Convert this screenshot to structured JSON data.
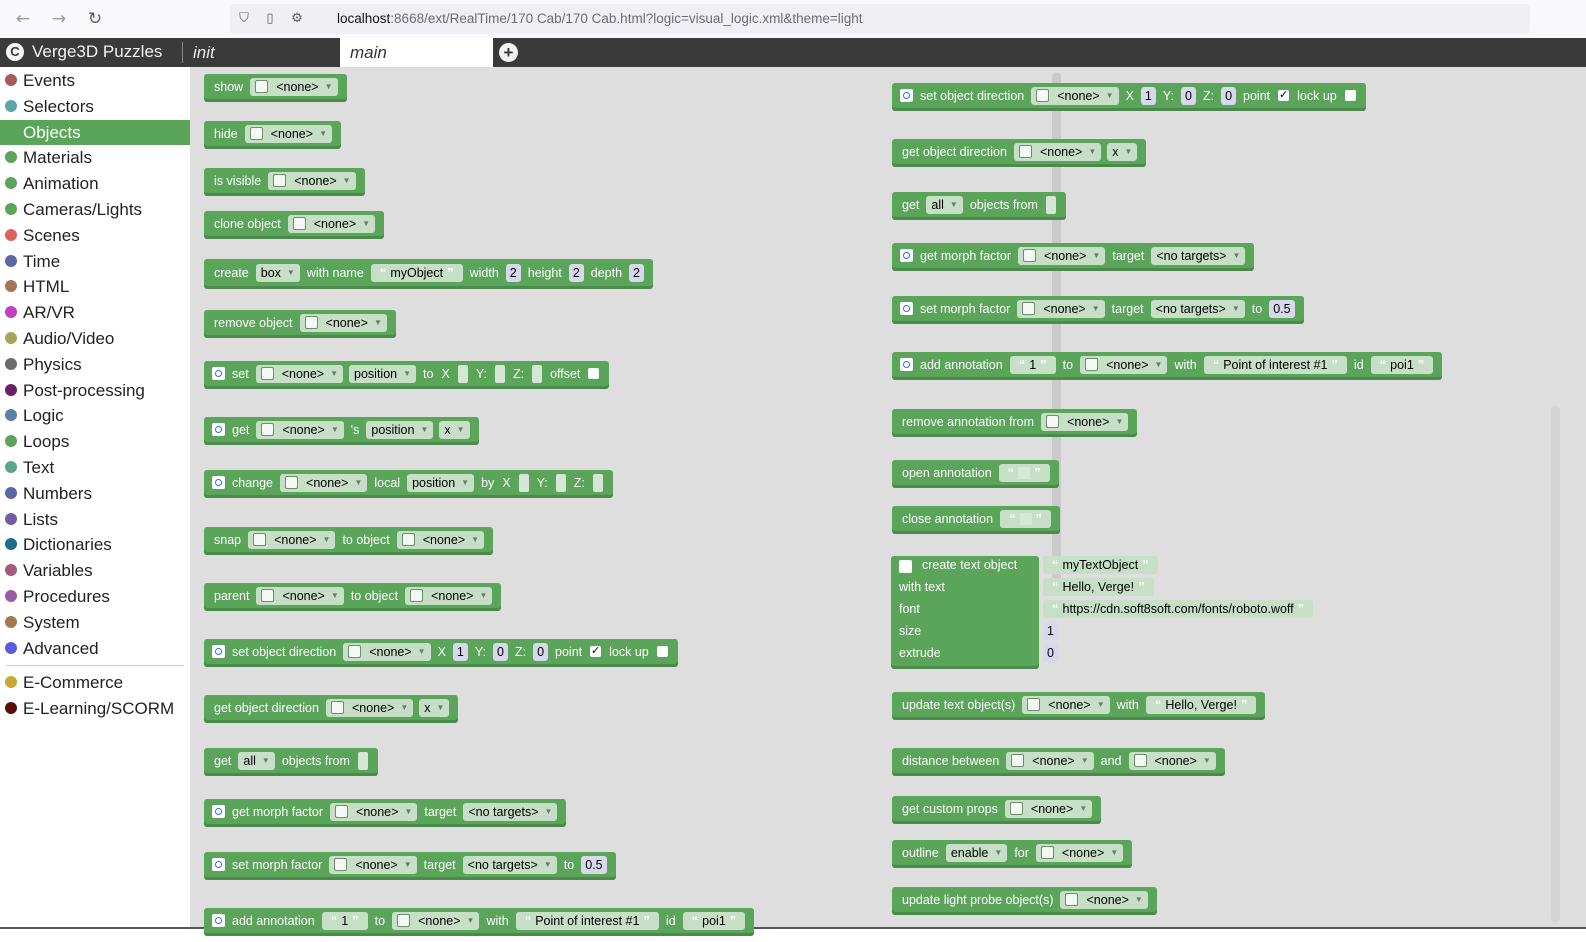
{
  "browser": {
    "url_host": "localhost",
    "url_rest": ":8668/ext/RealTime/170 Cab/170 Cab.html?logic=visual_logic.xml&theme=light"
  },
  "app": {
    "title": "Verge3D Puzzles",
    "tabs": [
      "init",
      "main"
    ]
  },
  "sidebar": {
    "categories": [
      {
        "label": "Events",
        "color": "#a55b5b"
      },
      {
        "label": "Selectors",
        "color": "#5ba5a5"
      },
      {
        "label": "Objects",
        "color": "#5ba55b"
      },
      {
        "label": "Materials",
        "color": "#5ba55b"
      },
      {
        "label": "Animation",
        "color": "#5ba55b"
      },
      {
        "label": "Cameras/Lights",
        "color": "#5ba55b"
      },
      {
        "label": "Scenes",
        "color": "#e06060"
      },
      {
        "label": "Time",
        "color": "#5b67a5"
      },
      {
        "label": "HTML",
        "color": "#a5745b"
      },
      {
        "label": "AR/VR",
        "color": "#c040c0"
      },
      {
        "label": "Audio/Video",
        "color": "#a5a55b"
      },
      {
        "label": "Physics",
        "color": "#6b6b6b"
      },
      {
        "label": "Post-processing",
        "color": "#6b1f6b"
      },
      {
        "label": "Logic",
        "color": "#5b80a5"
      },
      {
        "label": "Loops",
        "color": "#5ba55b"
      },
      {
        "label": "Text",
        "color": "#5ba58c"
      },
      {
        "label": "Numbers",
        "color": "#5b67a5"
      },
      {
        "label": "Lists",
        "color": "#745ba5"
      },
      {
        "label": "Dictionaries",
        "color": "#1f6b8c"
      },
      {
        "label": "Variables",
        "color": "#a55b80"
      },
      {
        "label": "Procedures",
        "color": "#995ba5"
      },
      {
        "label": "System",
        "color": "#a57a4a"
      },
      {
        "label": "Advanced",
        "color": "#5b5be0"
      },
      {
        "label": "E-Commerce",
        "color": "#c8a830"
      },
      {
        "label": "E-Learning/SCORM",
        "color": "#5a0f0f"
      }
    ],
    "selected": "Objects"
  },
  "blocks": {
    "show": "show",
    "hide": "hide",
    "is_visible": "is visible",
    "clone_object": "clone object",
    "none": "<none>",
    "create": "create",
    "box": "box",
    "with_name": "with name",
    "myObject": "myObject",
    "width": "width",
    "height": "height",
    "depth": "depth",
    "two": "2",
    "remove_object": "remove object",
    "set": "set",
    "position": "position",
    "to": "to",
    "x": "X",
    "y": "Y:",
    "z": "Z:",
    "offset": "offset",
    "get": "get",
    "s_position": "'s",
    "x_lower": "x",
    "change": "change",
    "local": "local",
    "by": "by",
    "snap": "snap",
    "to_object": "to object",
    "parent": "parent",
    "set_object_direction": "set object direction",
    "one": "1",
    "zero": "0",
    "point": "point",
    "check": "✓",
    "lock_up": "lock up",
    "get_object_direction": "get object direction",
    "all": "all",
    "objects_from": "objects from",
    "get_morph_factor": "get morph factor",
    "target": "target",
    "no_targets": "<no targets>",
    "set_morph_factor": "set morph factor",
    "half": "0.5",
    "add_annotation": "add annotation",
    "with": "with",
    "point_of_interest": "Point of interest #1",
    "id": "id",
    "poi1": "poi1",
    "remove_annotation_from": "remove annotation from",
    "open_annotation": "open annotation",
    "close_annotation": "close annotation",
    "create_text_object": "create text object",
    "myTextObject": "myTextObject",
    "with_text": "with text",
    "hello": "Hello, Verge!",
    "font": "font",
    "font_url": "https://cdn.soft8soft.com/fonts/roboto.woff",
    "size": "size",
    "extrude": "extrude",
    "update_text_objects": "update text object(s)",
    "distance_between": "distance between",
    "and": "and",
    "get_custom_props": "get custom props",
    "outline": "outline",
    "enable": "enable",
    "for": "for",
    "update_light_probe": "update light probe object(s)"
  }
}
